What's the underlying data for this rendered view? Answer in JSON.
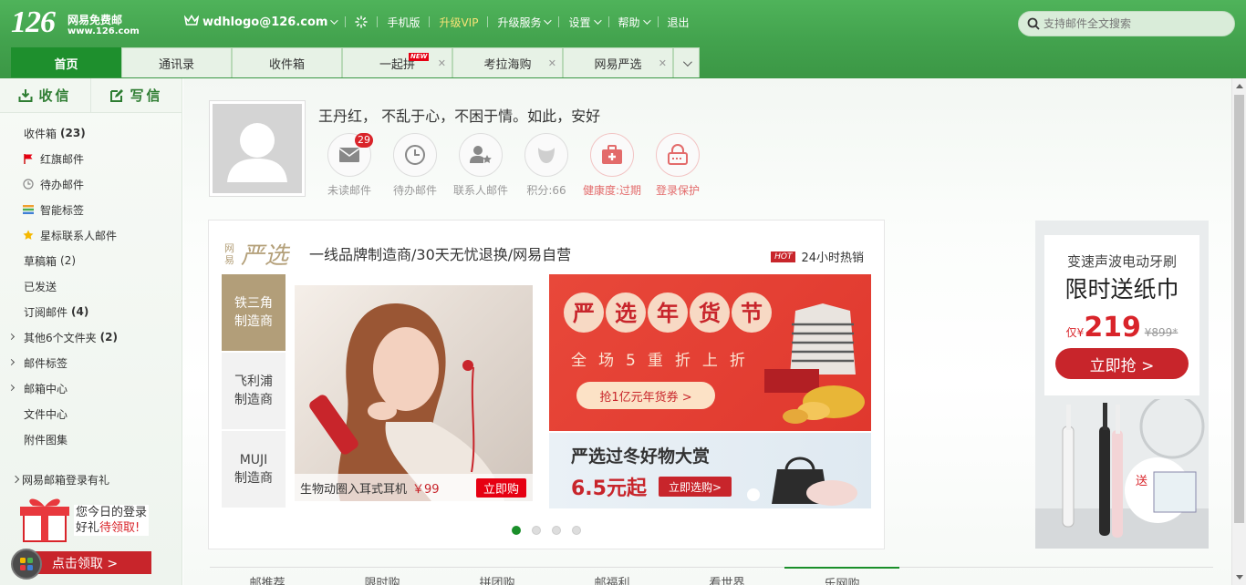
{
  "app": {
    "logo_number": "126",
    "logo_name": "网易免费邮",
    "logo_domain": "www.126.com"
  },
  "topnav": {
    "user": "wdhlogo@126.com",
    "items": [
      "手机版",
      "升级VIP",
      "升级服务",
      "设置",
      "帮助",
      "退出"
    ]
  },
  "search": {
    "placeholder": "支持邮件全文搜索"
  },
  "tabs": [
    {
      "label": "首页"
    },
    {
      "label": "通讯录"
    },
    {
      "label": "收件箱"
    },
    {
      "label": "一起拼",
      "badge": "NEW"
    },
    {
      "label": "考拉海购"
    },
    {
      "label": "网易严选"
    }
  ],
  "compose": {
    "receive": "收信",
    "write": "写信"
  },
  "folders": [
    {
      "label": "收件箱",
      "count": "(23)",
      "bold": true
    },
    {
      "label": "红旗邮件",
      "icon": "red-flag-icon"
    },
    {
      "label": "待办邮件",
      "icon": "clock-icon"
    },
    {
      "label": "智能标签",
      "icon": "tags-icon"
    },
    {
      "label": "星标联系人邮件",
      "icon": "star-icon"
    },
    {
      "label": "草稿箱",
      "count": "(2)"
    },
    {
      "label": "已发送"
    },
    {
      "label": "订阅邮件",
      "count": "(4)",
      "bold": true
    },
    {
      "label": "其他6个文件夹",
      "count": "(2)",
      "bold": true,
      "expand": true
    },
    {
      "label": "邮件标签",
      "expand": true
    },
    {
      "label": "邮箱中心",
      "expand": true
    },
    {
      "label": "文件中心"
    },
    {
      "label": "附件图集"
    }
  ],
  "gift": {
    "title": "网易邮箱登录有礼",
    "line1": "您今日的登录",
    "line2a": "好礼",
    "line2b": "待领取!",
    "button": "点击领取 >"
  },
  "profile": {
    "motto": "王丹红， 不乱于心，不困于情。如此，安好",
    "stats": [
      {
        "label": "未读邮件",
        "badge": "29"
      },
      {
        "label": "待办邮件"
      },
      {
        "label": "联系人邮件"
      },
      {
        "label": "积分:66"
      },
      {
        "label": "健康度:过期"
      },
      {
        "label": "登录保护"
      }
    ]
  },
  "promo": {
    "brand_small": "网易",
    "brand_big": "严选",
    "slogan": "一线品牌制造商/30天无忧退换/网易自营",
    "hot_tag": "HOT",
    "hot_label": "24小时热销",
    "makers": [
      {
        "line1": "铁三角",
        "line2": "制造商"
      },
      {
        "line1": "飞利浦",
        "line2": "制造商"
      },
      {
        "line1": "MUJI",
        "line2": "制造商"
      }
    ],
    "product": {
      "name": "生物动圈入耳式耳机",
      "price": "￥99",
      "buy": "立即购"
    },
    "banner1": {
      "title": "严选年货节",
      "sub": "全场5重折上折",
      "coupon": "抢1亿元年货券 >"
    },
    "banner2": {
      "title": "严选过冬好物大赏",
      "price": "6.5元起",
      "button": "立即选购>"
    },
    "dots": 4
  },
  "ad": {
    "line1": "变速声波电动牙刷",
    "line2": "限时送纸巾",
    "price_prefix": "仅¥",
    "price": "219",
    "old_price": "¥899*",
    "button": "立即抢 >",
    "gift_tag": "送"
  },
  "bottom_tabs": [
    "邮推荐",
    "限时购",
    "拼团购",
    "邮福利",
    "看世界",
    "乐网购"
  ]
}
